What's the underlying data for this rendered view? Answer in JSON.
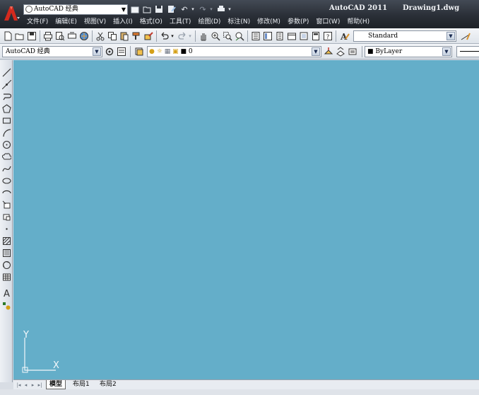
{
  "titlebar": {
    "workspace_combo": "AutoCAD 经典",
    "app_title": "AutoCAD 2011",
    "doc_title": "Drawing1.dwg"
  },
  "menu": [
    "文件(F)",
    "编辑(E)",
    "视图(V)",
    "插入(I)",
    "格式(O)",
    "工具(T)",
    "绘图(D)",
    "标注(N)",
    "修改(M)",
    "参数(P)",
    "窗口(W)",
    "帮助(H)"
  ],
  "toolbar1": {
    "text_style": "Standard"
  },
  "toolbar2": {
    "workspace": "AutoCAD 经典",
    "layer": "0",
    "color": "ByLayer"
  },
  "drawbar_tools": [
    "line-icon",
    "construction-line-icon",
    "polyline-icon",
    "polygon-icon",
    "rectangle-icon",
    "arc-icon",
    "circle-icon",
    "revision-cloud-icon",
    "spline-icon",
    "ellipse-icon",
    "ellipse-arc-icon",
    "insert-block-icon",
    "make-block-icon",
    "point-icon",
    "hatch-icon",
    "gradient-icon",
    "region-icon",
    "table-icon",
    "multiline-text-icon",
    "add-selected-icon"
  ],
  "canvas": {
    "background": "#64aec9",
    "ucs_x": "X",
    "ucs_y": "Y"
  },
  "layout_tabs": [
    "模型",
    "布局1",
    "布局2"
  ],
  "colors": {
    "title_bg": "#2a2f37",
    "canvas_bg": "#64aec9",
    "logo_red": "#d42a1e"
  }
}
